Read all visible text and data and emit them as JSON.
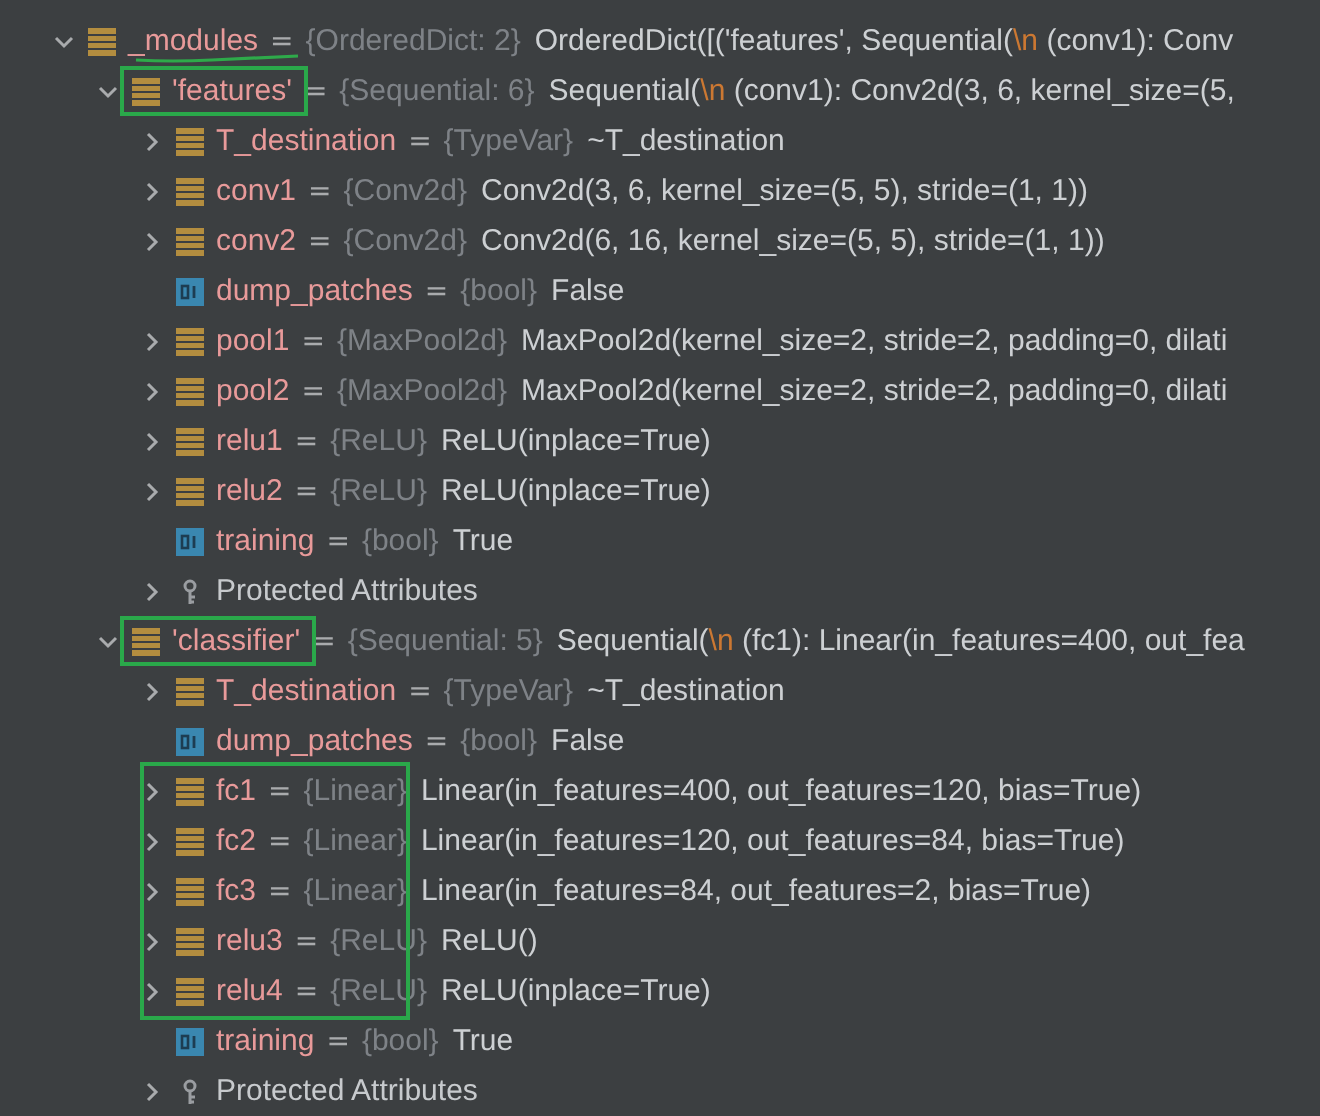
{
  "tree": [
    {
      "name": "_modules",
      "equals": "=",
      "type": "{OrderedDict: 2}",
      "kind": "object",
      "expanded": true,
      "underlined": true,
      "value_parts": [
        {
          "kind": "plain",
          "text": "OrderedDict([('features', Sequential("
        },
        {
          "kind": "escape",
          "text": "\\n"
        },
        {
          "kind": "plain",
          "text": "  (conv1): Conv"
        }
      ],
      "children": [
        {
          "name": "'features'",
          "equals": "=",
          "type": "{Sequential: 6}",
          "kind": "object",
          "expanded": true,
          "boxed": true,
          "value_parts": [
            {
              "kind": "plain",
              "text": "Sequential("
            },
            {
              "kind": "escape",
              "text": "\\n"
            },
            {
              "kind": "plain",
              "text": "  (conv1): Conv2d(3, 6, kernel_size=(5,"
            }
          ],
          "children": [
            {
              "name": "T_destination",
              "equals": "=",
              "type": "{TypeVar}",
              "kind": "object",
              "expanded": false,
              "value": "~T_destination"
            },
            {
              "name": "conv1",
              "equals": "=",
              "type": "{Conv2d}",
              "kind": "object",
              "expanded": false,
              "value": "Conv2d(3, 6, kernel_size=(5, 5), stride=(1, 1))"
            },
            {
              "name": "conv2",
              "equals": "=",
              "type": "{Conv2d}",
              "kind": "object",
              "expanded": false,
              "value": "Conv2d(6, 16, kernel_size=(5, 5), stride=(1, 1))"
            },
            {
              "name": "dump_patches",
              "equals": "=",
              "type": "{bool}",
              "kind": "bool",
              "value": "False"
            },
            {
              "name": "pool1",
              "equals": "=",
              "type": "{MaxPool2d}",
              "kind": "object",
              "expanded": false,
              "value": "MaxPool2d(kernel_size=2, stride=2, padding=0, dilati"
            },
            {
              "name": "pool2",
              "equals": "=",
              "type": "{MaxPool2d}",
              "kind": "object",
              "expanded": false,
              "value": "MaxPool2d(kernel_size=2, stride=2, padding=0, dilati"
            },
            {
              "name": "relu1",
              "equals": "=",
              "type": "{ReLU}",
              "kind": "object",
              "expanded": false,
              "value": "ReLU(inplace=True)"
            },
            {
              "name": "relu2",
              "equals": "=",
              "type": "{ReLU}",
              "kind": "object",
              "expanded": false,
              "value": "ReLU(inplace=True)"
            },
            {
              "name": "training",
              "equals": "=",
              "type": "{bool}",
              "kind": "bool",
              "value": "True"
            },
            {
              "name": "Protected Attributes",
              "kind": "protected",
              "expanded": false
            }
          ]
        },
        {
          "name": "'classifier'",
          "equals": "=",
          "type": "{Sequential: 5}",
          "kind": "object",
          "expanded": true,
          "boxed": true,
          "value_parts": [
            {
              "kind": "plain",
              "text": "Sequential("
            },
            {
              "kind": "escape",
              "text": "\\n"
            },
            {
              "kind": "plain",
              "text": "  (fc1): Linear(in_features=400, out_fea"
            }
          ],
          "children": [
            {
              "name": "T_destination",
              "equals": "=",
              "type": "{TypeVar}",
              "kind": "object",
              "expanded": false,
              "value": "~T_destination"
            },
            {
              "name": "dump_patches",
              "equals": "=",
              "type": "{bool}",
              "kind": "bool",
              "value": "False"
            },
            {
              "name": "fc1",
              "equals": "=",
              "type": "{Linear}",
              "kind": "object",
              "expanded": false,
              "group_boxed": true,
              "value": "Linear(in_features=400, out_features=120, bias=True)"
            },
            {
              "name": "fc2",
              "equals": "=",
              "type": "{Linear}",
              "kind": "object",
              "expanded": false,
              "group_boxed": true,
              "value": "Linear(in_features=120, out_features=84, bias=True)"
            },
            {
              "name": "fc3",
              "equals": "=",
              "type": "{Linear}",
              "kind": "object",
              "expanded": false,
              "group_boxed": true,
              "value": "Linear(in_features=84, out_features=2, bias=True)"
            },
            {
              "name": "relu3",
              "equals": "=",
              "type": "{ReLU}",
              "kind": "object",
              "expanded": false,
              "group_boxed": true,
              "value": "ReLU()"
            },
            {
              "name": "relu4",
              "equals": "=",
              "type": "{ReLU}",
              "kind": "object",
              "expanded": false,
              "group_boxed": true,
              "value": "ReLU(inplace=True)"
            },
            {
              "name": "training",
              "equals": "=",
              "type": "{bool}",
              "kind": "bool",
              "value": "True"
            },
            {
              "name": "Protected Attributes",
              "kind": "protected",
              "expanded": false
            }
          ]
        }
      ]
    }
  ]
}
